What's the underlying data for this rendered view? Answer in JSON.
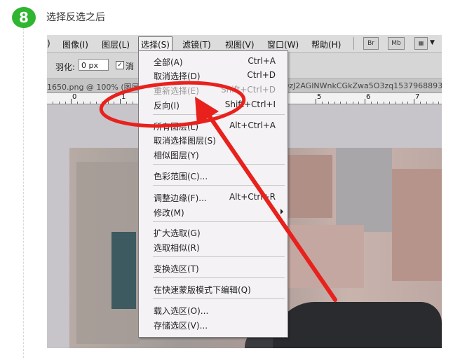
{
  "step": {
    "number": "8",
    "title": "选择反选之后"
  },
  "menubar": {
    "items": [
      {
        "label": ")",
        "active": false
      },
      {
        "label": "图像(I)",
        "active": false
      },
      {
        "label": "图层(L)",
        "active": false
      },
      {
        "label": "选择(S)",
        "active": true
      },
      {
        "label": "滤镜(T)",
        "active": false
      },
      {
        "label": "视图(V)",
        "active": false
      },
      {
        "label": "窗口(W)",
        "active": false
      },
      {
        "label": "帮助(H)",
        "active": false
      }
    ],
    "bridge_label": "Br",
    "minibridge_label": "Mb",
    "arrange_arrow": "▼"
  },
  "options": {
    "feather_label": "羽化:",
    "feather_value": "0 px",
    "antialias_label": "消",
    "antialias_checked": "✓"
  },
  "doc_tab": {
    "left_text": "1650.png @ 100% (图层",
    "right_text": "OOzJ2AGINWnkCGkZwa5O3zq1537968893"
  },
  "ruler": {
    "labels": [
      "0",
      "1",
      "5",
      "6",
      "7"
    ]
  },
  "select_menu": {
    "items": [
      {
        "label": "全部(A)",
        "shortcut": "Ctrl+A",
        "disabled": false
      },
      {
        "label": "取消选择(D)",
        "shortcut": "Ctrl+D",
        "disabled": false
      },
      {
        "label": "重新选择(E)",
        "shortcut": "Shift+Ctrl+D",
        "disabled": true
      },
      {
        "label": "反向(I)",
        "shortcut": "Shift+Ctrl+I",
        "disabled": false
      },
      {
        "label": "所有图层(L)",
        "shortcut": "Alt+Ctrl+A",
        "disabled": false
      },
      {
        "label": "取消选择图层(S)",
        "shortcut": "",
        "disabled": false
      },
      {
        "label": "相似图层(Y)",
        "shortcut": "",
        "disabled": false
      },
      {
        "label": "色彩范围(C)...",
        "shortcut": "",
        "disabled": false
      },
      {
        "label": "调整边缘(F)...",
        "shortcut": "Alt+Ctrl+R",
        "disabled": false
      },
      {
        "label": "修改(M)",
        "shortcut": "",
        "disabled": false,
        "submenu": true
      },
      {
        "label": "扩大选取(G)",
        "shortcut": "",
        "disabled": false
      },
      {
        "label": "选取相似(R)",
        "shortcut": "",
        "disabled": false
      },
      {
        "label": "变换选区(T)",
        "shortcut": "",
        "disabled": false
      },
      {
        "label": "在快速蒙版模式下编辑(Q)",
        "shortcut": "",
        "disabled": false
      },
      {
        "label": "载入选区(O)...",
        "shortcut": "",
        "disabled": false
      },
      {
        "label": "存储选区(V)...",
        "shortcut": "",
        "disabled": false
      }
    ]
  },
  "colors": {
    "badge": "#2fb52f",
    "annotation": "#e8211c"
  }
}
